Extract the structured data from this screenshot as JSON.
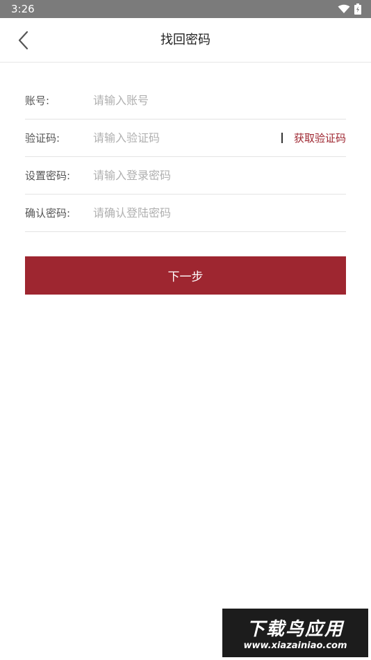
{
  "status_bar": {
    "time": "3:26"
  },
  "nav": {
    "title": "找回密码",
    "back_icon": "chevron-left-icon"
  },
  "form": {
    "account": {
      "label": "账号:",
      "placeholder": "请输入账号"
    },
    "verify_code": {
      "label": "验证码:",
      "placeholder": "请输入验证码",
      "get_code_label": "获取验证码"
    },
    "new_password": {
      "label": "设置密码:",
      "placeholder": "请输入登录密码"
    },
    "confirm_password": {
      "label": "确认密码:",
      "placeholder": "请确认登陆密码"
    }
  },
  "next_button": {
    "label": "下一步"
  },
  "watermark": {
    "title": "下载鸟应用",
    "url": "www.xiazainiao.com"
  },
  "colors": {
    "accent": "#9e2630",
    "status_bar": "#7b7b7b"
  }
}
